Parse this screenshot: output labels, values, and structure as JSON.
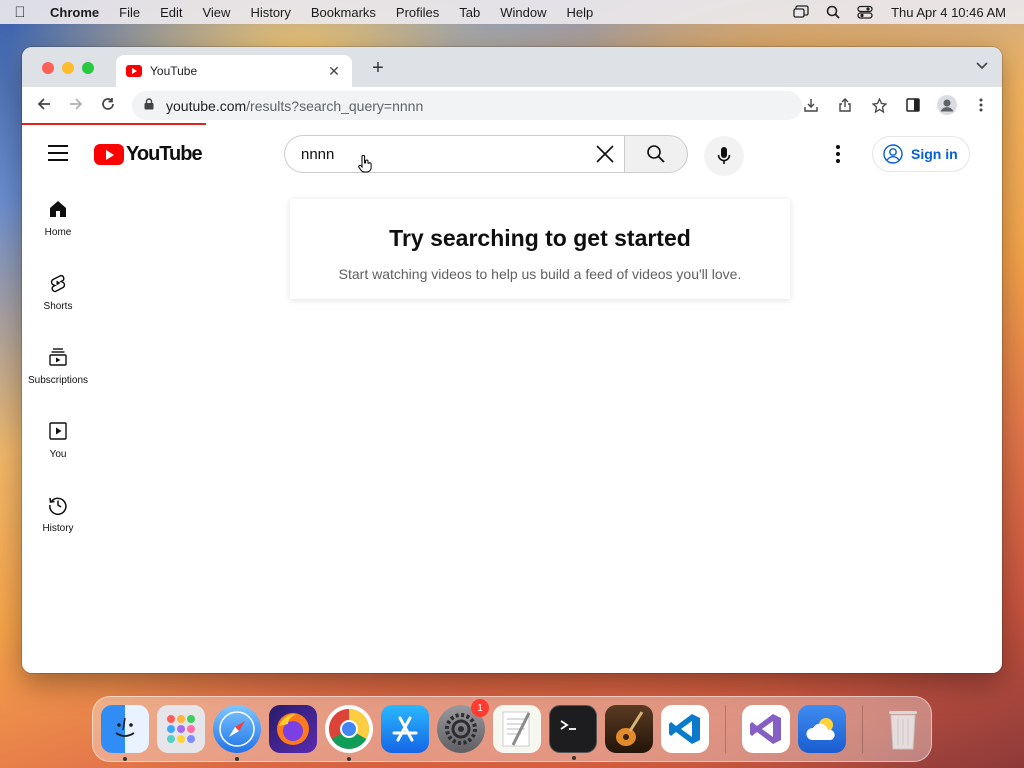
{
  "menubar": {
    "app_name": "Chrome",
    "items": [
      "File",
      "Edit",
      "View",
      "History",
      "Bookmarks",
      "Profiles",
      "Tab",
      "Window",
      "Help"
    ],
    "clock": "Thu Apr 4  10:46 AM"
  },
  "browser": {
    "tab_title": "YouTube",
    "url_host": "youtube.com",
    "url_path": "/results?search_query=nnnn"
  },
  "youtube": {
    "logo_text": "YouTube",
    "search_value": "nnnn",
    "signin_label": "Sign in",
    "nav": [
      {
        "label": "Home",
        "icon": "home-icon"
      },
      {
        "label": "Shorts",
        "icon": "shorts-icon"
      },
      {
        "label": "Subscriptions",
        "icon": "subscriptions-icon"
      },
      {
        "label": "You",
        "icon": "you-icon"
      },
      {
        "label": "History",
        "icon": "history-icon"
      }
    ],
    "card": {
      "title": "Try searching to get started",
      "subtitle": "Start watching videos to help us build a feed of videos you'll love."
    }
  },
  "dock": {
    "apps": [
      "Finder",
      "Launchpad",
      "Safari",
      "Firefox",
      "Chrome",
      "App Store",
      "System Settings",
      "TextEdit",
      "Terminal",
      "GarageBand",
      "Visual Studio Code",
      "Visual Studio",
      "Weather",
      "Trash"
    ],
    "settings_badge": "1"
  },
  "colors": {
    "yt_red": "#ff0000",
    "signin_blue": "#065fd4",
    "load_bar": "#e2211c"
  }
}
